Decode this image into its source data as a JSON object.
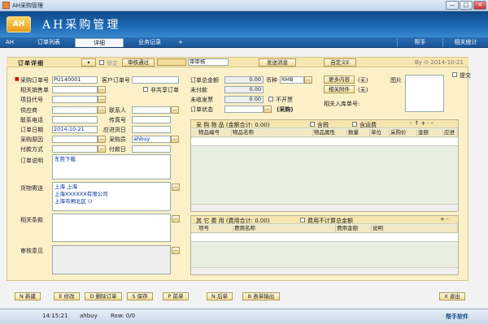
{
  "window": {
    "title": "AH采购管理",
    "min": "—",
    "max": "□",
    "close": "✕"
  },
  "app": {
    "logo": "AH",
    "title": "AH采购管理"
  },
  "tabs": [
    {
      "label": "AH"
    },
    {
      "label": "订单列表"
    },
    {
      "label": "详细"
    },
    {
      "label": "业务记录"
    },
    {
      "label": "+"
    }
  ],
  "top_links": {
    "help": "帮手",
    "related": "相关统计"
  },
  "toolbar": {
    "section_title": "订单详细",
    "lock_label": "锁定",
    "review_pass": "审核通过",
    "review_select": "审审核",
    "send_msg": "发送消息",
    "custom_doc": "自定义E",
    "by_date": "By ⊙ 2014-10-21",
    "reminder": "提交"
  },
  "form": {
    "order_no_label": "采购订单号",
    "order_no": "PU140001",
    "customer_order_label": "客户订单号",
    "customer_order": "",
    "sales_doc_label": "相关销售单",
    "shared_label": "非共享订单",
    "project_label": "项目代号",
    "supplier_label": "供应商",
    "contact_label": "联系人",
    "phone_label": "联系电话",
    "fax_label": "传真号",
    "order_date_label": "订单日期",
    "order_date": "2014-10-21",
    "arrive_label": "应进货日",
    "reason_label": "采购原因",
    "buyer_label": "采购员",
    "buyer": "ahbuy",
    "pay_method_label": "付款方式",
    "pay_date_label": "付款日",
    "note_label": "订单说明",
    "note": "东莞下载",
    "ship_label": "货物寄送",
    "ship_lines": [
      "上海 上海",
      "上海XXXXXX有限公司",
      "上海市闸北区 ()"
    ],
    "terms_label": "相关条款",
    "review_label": "审核意见",
    "total_label": "订单总金额",
    "total": "0.00",
    "currency_label": "币种",
    "currency": "RMB",
    "unpaid_label": "未付款",
    "unpaid": "0.00",
    "uninvoiced_label": "未收发票",
    "uninvoiced": "0.00",
    "no_invoice_label": "不开票",
    "status_label": "订单状态",
    "status": "(采购)",
    "more_btn": "更多内容",
    "more_val": "(无)",
    "attach_btn": "相关附件",
    "attach_val": "(无)",
    "image_label": "图片",
    "stockin_label": "相关入库单号:"
  },
  "goods": {
    "title": "采 购 物 品 (金额合计: 0.00)",
    "tax_label": "含税",
    "tax_freight_label": "含运费",
    "columns": [
      "物品编号",
      "物品名称",
      "物品属性",
      "数量",
      "单位",
      "采购价",
      "金额",
      "应进"
    ]
  },
  "fees": {
    "title": "其 它 费 用 (费用合计: 0.00)",
    "exclude_label": "费用不计算总金额",
    "columns": [
      "项号",
      "费用名称",
      "费用金额",
      "说明"
    ]
  },
  "bottom_buttons": [
    "新建",
    "修改",
    "删除订单",
    "保存",
    "前单",
    "后单",
    "表单输出"
  ],
  "exit_button": "退出",
  "status": {
    "time": "14:15:21",
    "user": "ahbuy",
    "row": "Row: 0/0",
    "brand": "帮手软件"
  }
}
